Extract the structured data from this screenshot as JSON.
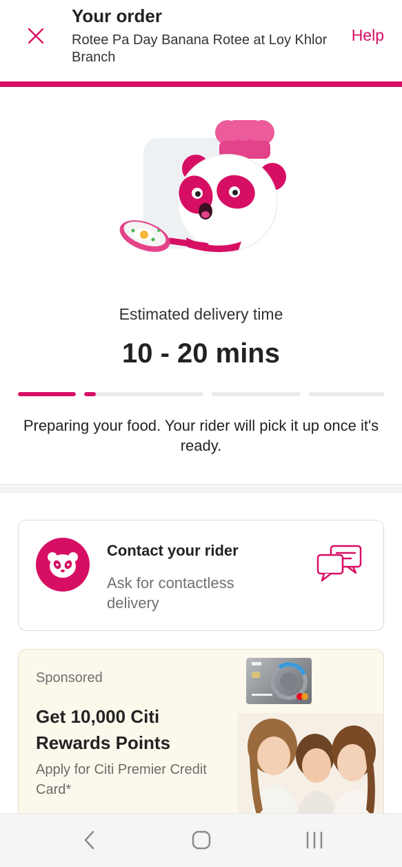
{
  "header": {
    "title": "Your order",
    "restaurant": "Rotee Pa Day Banana Rotee at Loy Khlor Branch",
    "help_label": "Help",
    "close_icon": "close-icon"
  },
  "tracking": {
    "eta_label": "Estimated delivery time",
    "eta_value": "10 - 20 mins",
    "progress_steps": [
      1.0,
      0.1,
      0,
      0
    ],
    "status_message": "Preparing your food. Your rider will pick it up once it's ready."
  },
  "contact": {
    "title": "Contact your rider",
    "subtitle": "Ask for contactless delivery",
    "avatar_icon": "panda-icon",
    "action_icon": "chat-bubbles-icon"
  },
  "sponsored": {
    "label": "Sponsored",
    "title": "Get 10,000 Citi Rewards Points",
    "subtitle": "Apply for Citi Premier Credit Card*"
  },
  "navbar": {
    "back_icon": "back-chevron-icon",
    "home_icon": "home-icon",
    "recents_icon": "recents-icon"
  },
  "colors": {
    "brand": "#d70f64",
    "track": "#ebebeb",
    "sponsor_bg": "#fdf8ec"
  }
}
